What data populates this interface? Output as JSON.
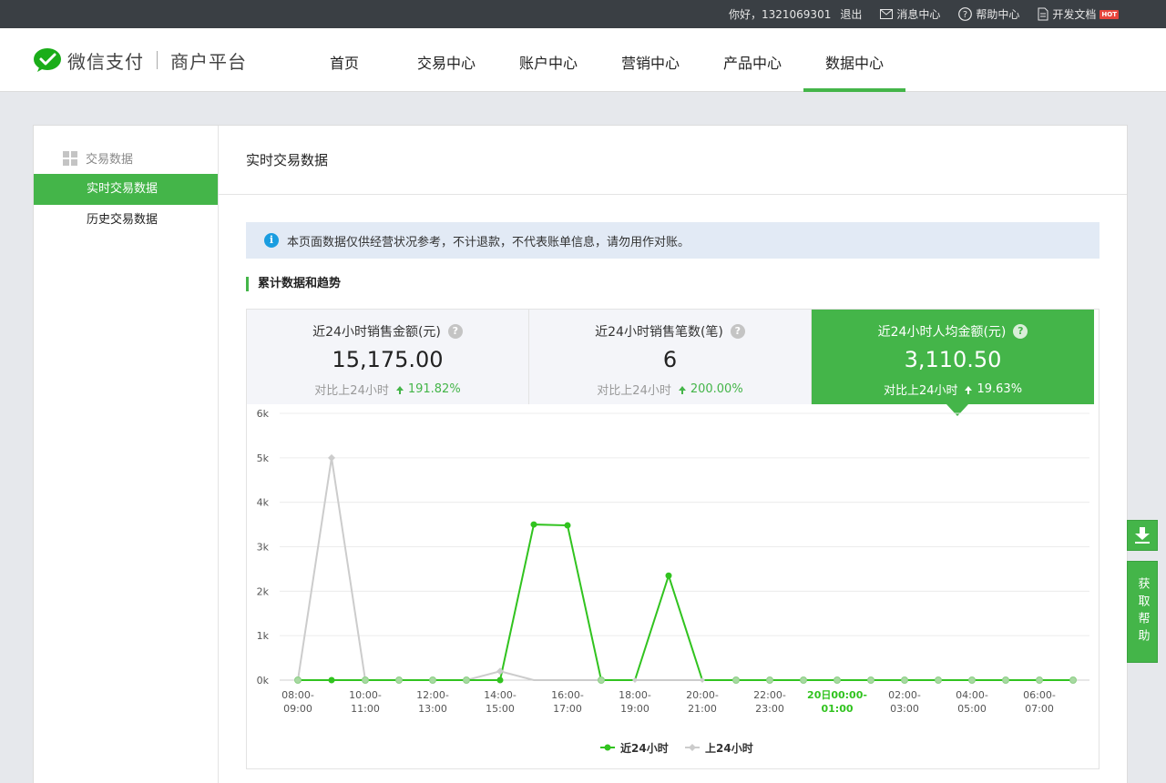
{
  "topbar": {
    "greeting": "你好，1321069301",
    "logout": "退出",
    "messages": "消息中心",
    "help": "帮助中心",
    "docs": "开发文档",
    "docs_badge": "HOT"
  },
  "header": {
    "brand": "微信支付",
    "subtitle": "商户平台",
    "nav": [
      "首页",
      "交易中心",
      "账户中心",
      "营销中心",
      "产品中心",
      "数据中心"
    ],
    "active_nav": "数据中心"
  },
  "sidebar": {
    "section": "交易数据",
    "items": [
      "实时交易数据",
      "历史交易数据"
    ],
    "active": "实时交易数据"
  },
  "content": {
    "title": "实时交易数据",
    "notice": "本页面数据仅供经营状况参考，不计退款，不代表账单信息，请勿用作对账。",
    "section_title": "累计数据和趋势"
  },
  "cards": [
    {
      "label": "近24小时销售金额(元)",
      "value": "15,175.00",
      "compare": "对比上24小时",
      "change": "191.82%"
    },
    {
      "label": "近24小时销售笔数(笔)",
      "value": "6",
      "compare": "对比上24小时",
      "change": "200.00%"
    },
    {
      "label": "近24小时人均金额(元)",
      "value": "3,110.50",
      "compare": "对比上24小时",
      "change": "19.63%"
    }
  ],
  "chart_data": {
    "type": "line",
    "title": "",
    "xlabel": "",
    "ylabel": "",
    "ylim": [
      0,
      6000
    ],
    "y_ticks": [
      "0k",
      "1k",
      "2k",
      "3k",
      "4k",
      "5k",
      "6k"
    ],
    "x_labels": [
      [
        "08:00-",
        "09:00"
      ],
      [
        "10:00-",
        "11:00"
      ],
      [
        "12:00-",
        "13:00"
      ],
      [
        "14:00-",
        "15:00"
      ],
      [
        "16:00-",
        "17:00"
      ],
      [
        "18:00-",
        "19:00"
      ],
      [
        "20:00-",
        "21:00"
      ],
      [
        "22:00-",
        "23:00"
      ],
      [
        "20日00:00-",
        "01:00"
      ],
      [
        "02:00-",
        "03:00"
      ],
      [
        "04:00-",
        "05:00"
      ],
      [
        "06:00-",
        "07:00"
      ]
    ],
    "highlight_label_index": 8,
    "grid": true,
    "legend_position": "bottom-center",
    "series": [
      {
        "name": "近24小时",
        "color": "#31c31f",
        "values": [
          0,
          0,
          0,
          0,
          0,
          0,
          0,
          3500,
          3480,
          0,
          0,
          2350,
          0,
          0,
          0,
          0,
          0,
          0,
          0,
          0,
          0,
          0,
          0,
          0
        ]
      },
      {
        "name": "上24小时",
        "color": "#cccccc",
        "values": [
          0,
          5000,
          0,
          0,
          0,
          0,
          200,
          0,
          0,
          0,
          0,
          0,
          0,
          0,
          0,
          0,
          0,
          0,
          0,
          0,
          0,
          0,
          0,
          0
        ]
      }
    ]
  },
  "float": {
    "help": "获取帮助"
  }
}
